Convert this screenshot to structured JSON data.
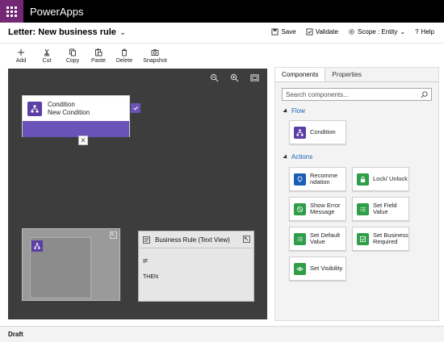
{
  "app": {
    "title": "PowerApps"
  },
  "header": {
    "title": "Letter: New business rule",
    "actions": [
      {
        "label": "Save",
        "icon": "save-icon"
      },
      {
        "label": "Validate",
        "icon": "validate-icon"
      },
      {
        "label": "Scope : Entity",
        "icon": "gear-icon"
      },
      {
        "label": "Help",
        "icon": "help-icon"
      }
    ]
  },
  "toolbar": {
    "add": "Add",
    "cut": "Cut",
    "copy": "Copy",
    "paste": "Paste",
    "delete": "Delete",
    "snapshot": "Snapshot"
  },
  "canvas": {
    "condition": {
      "title": "Condition",
      "subtitle": "New Condition"
    },
    "text_view": {
      "title": "Business Rule (Text View)",
      "if": "IF",
      "then": "THEN"
    }
  },
  "panel": {
    "tabs": [
      "Components",
      "Properties"
    ],
    "search_placeholder": "Search components...",
    "flow": {
      "heading": "Flow",
      "items": [
        {
          "label": "Condition",
          "color": "#5b3ea6"
        }
      ]
    },
    "actions": {
      "heading": "Actions",
      "items": [
        {
          "label": "Recomme ndation",
          "color": "#1a5fb4",
          "icon": "lightbulb-icon"
        },
        {
          "label": "Lock/ Unlock",
          "color": "#2e9e48",
          "icon": "lock-icon"
        },
        {
          "label": "Show Error Message",
          "color": "#2e9e48",
          "icon": "error-icon"
        },
        {
          "label": "Set Field Value",
          "color": "#2e9e48",
          "icon": "list-icon"
        },
        {
          "label": "Set Default Value",
          "color": "#2e9e48",
          "icon": "list-icon"
        },
        {
          "label": "Set Business Required",
          "color": "#2e9e48",
          "icon": "checkbox-icon"
        },
        {
          "label": "Set Visibility",
          "color": "#2e9e48",
          "icon": "eye-icon"
        }
      ]
    }
  },
  "status": {
    "text": "Draft"
  }
}
